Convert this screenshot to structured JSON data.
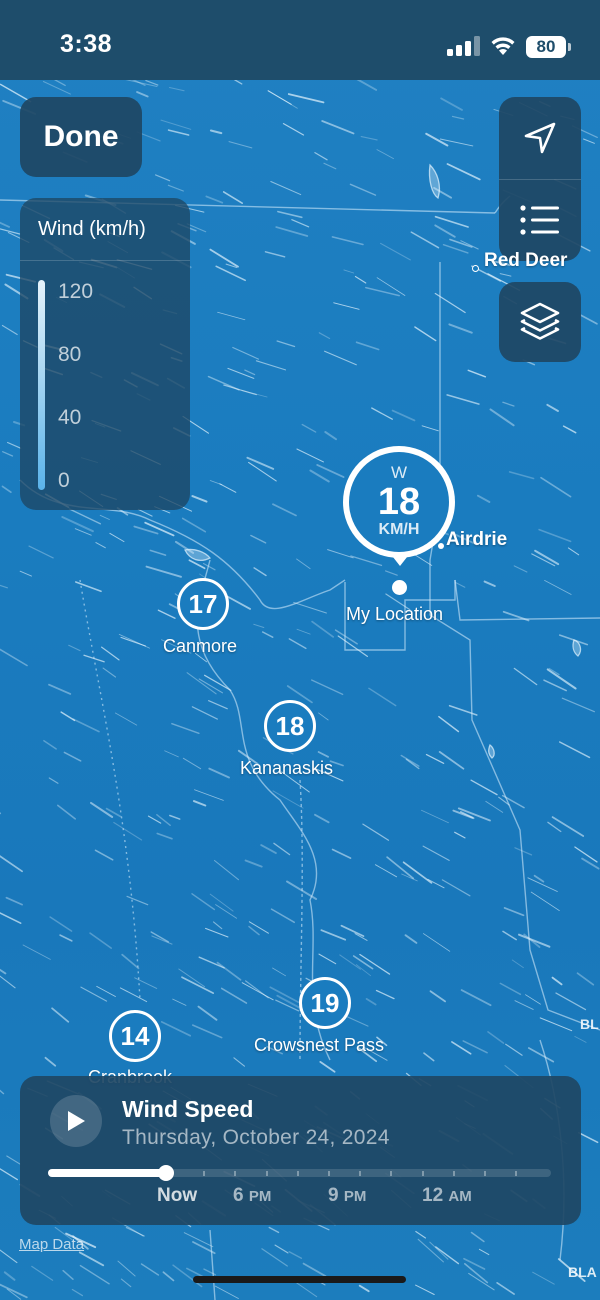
{
  "status_bar": {
    "time": "3:38",
    "battery": "80"
  },
  "top_left": {
    "done_label": "Done"
  },
  "legend": {
    "title": "Wind (km/h)",
    "labels": [
      "120",
      "80",
      "40",
      "0"
    ]
  },
  "controls": {
    "locate_icon": "location-arrow-icon",
    "list_icon": "list-icon",
    "layers_icon": "layers-icon"
  },
  "current_location": {
    "direction": "W",
    "speed": "18",
    "unit": "KM/H",
    "label": "My Location"
  },
  "places": [
    {
      "name": "Red Deer"
    },
    {
      "name": "Airdrie"
    },
    {
      "name": "Canmore",
      "wind": "17"
    },
    {
      "name": "Kananaskis",
      "wind": "18"
    },
    {
      "name": "Crowsnest Pass",
      "wind": "19"
    },
    {
      "name": "Cranbrook",
      "wind": "14"
    }
  ],
  "edge_labels": [
    "BL",
    "BLA"
  ],
  "timeline": {
    "title": "Wind Speed",
    "date": "Thursday, October 24, 2024",
    "labels": [
      {
        "hour": "Now",
        "ampm": ""
      },
      {
        "hour": "6",
        "ampm": "PM"
      },
      {
        "hour": "9",
        "ampm": "PM"
      },
      {
        "hour": "12",
        "ampm": "AM"
      }
    ]
  },
  "footer": {
    "map_data_link": "Map Data"
  },
  "colors": {
    "water_blue": "#1a7cbf",
    "panel": "#1e4d6b"
  }
}
